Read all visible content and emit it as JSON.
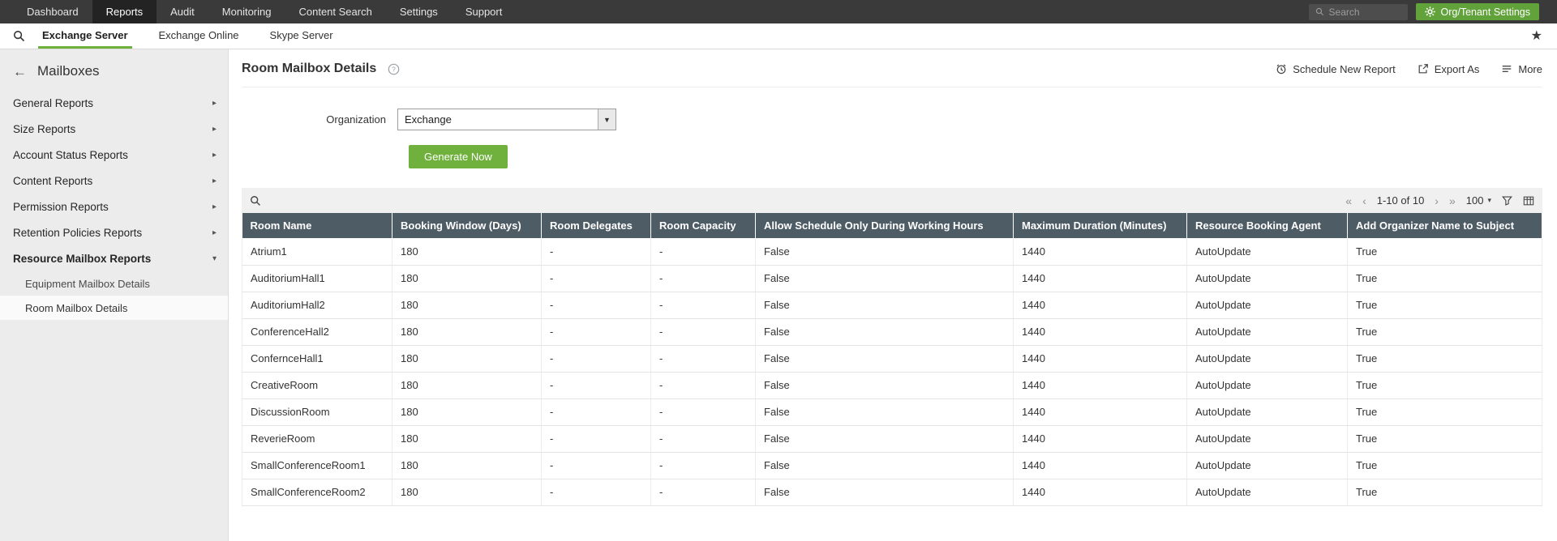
{
  "top_nav": {
    "items": [
      {
        "label": "Dashboard",
        "active": false
      },
      {
        "label": "Reports",
        "active": true
      },
      {
        "label": "Audit",
        "active": false
      },
      {
        "label": "Monitoring",
        "active": false
      },
      {
        "label": "Content Search",
        "active": false
      },
      {
        "label": "Settings",
        "active": false
      },
      {
        "label": "Support",
        "active": false
      }
    ],
    "search_placeholder": "Search",
    "org_settings_label": "Org/Tenant Settings"
  },
  "sub_nav": {
    "tabs": [
      {
        "label": "Exchange Server",
        "active": true
      },
      {
        "label": "Exchange Online",
        "active": false
      },
      {
        "label": "Skype Server",
        "active": false
      }
    ]
  },
  "sidebar": {
    "title": "Mailboxes",
    "items": [
      {
        "label": "General Reports",
        "expanded": false
      },
      {
        "label": "Size Reports",
        "expanded": false
      },
      {
        "label": "Account Status Reports",
        "expanded": false
      },
      {
        "label": "Content Reports",
        "expanded": false
      },
      {
        "label": "Permission Reports",
        "expanded": false
      },
      {
        "label": "Retention Policies Reports",
        "expanded": false
      },
      {
        "label": "Resource Mailbox Reports",
        "expanded": true,
        "children": [
          {
            "label": "Equipment Mailbox Details",
            "selected": false
          },
          {
            "label": "Room Mailbox Details",
            "selected": true
          }
        ]
      }
    ]
  },
  "main": {
    "title": "Room Mailbox Details",
    "actions": {
      "schedule": "Schedule New Report",
      "export": "Export As",
      "more": "More"
    },
    "form": {
      "organization_label": "Organization",
      "organization_value": "Exchange"
    },
    "generate_button": "Generate Now",
    "pagination": {
      "range": "1-10 of 10",
      "page_size": "100"
    },
    "table": {
      "columns": [
        "Room Name",
        "Booking Window (Days)",
        "Room Delegates",
        "Room Capacity",
        "Allow Schedule Only During Working Hours",
        "Maximum Duration (Minutes)",
        "Resource Booking Agent",
        "Add Organizer Name to Subject"
      ],
      "rows": [
        [
          "Atrium1",
          "180",
          "-",
          "-",
          "False",
          "1440",
          "AutoUpdate",
          "True"
        ],
        [
          "AuditoriumHall1",
          "180",
          "-",
          "-",
          "False",
          "1440",
          "AutoUpdate",
          "True"
        ],
        [
          "AuditoriumHall2",
          "180",
          "-",
          "-",
          "False",
          "1440",
          "AutoUpdate",
          "True"
        ],
        [
          "ConferenceHall2",
          "180",
          "-",
          "-",
          "False",
          "1440",
          "AutoUpdate",
          "True"
        ],
        [
          "ConfernceHall1",
          "180",
          "-",
          "-",
          "False",
          "1440",
          "AutoUpdate",
          "True"
        ],
        [
          "CreativeRoom",
          "180",
          "-",
          "-",
          "False",
          "1440",
          "AutoUpdate",
          "True"
        ],
        [
          "DiscussionRoom",
          "180",
          "-",
          "-",
          "False",
          "1440",
          "AutoUpdate",
          "True"
        ],
        [
          "ReverieRoom",
          "180",
          "-",
          "-",
          "False",
          "1440",
          "AutoUpdate",
          "True"
        ],
        [
          "SmallConferenceRoom1",
          "180",
          "-",
          "-",
          "False",
          "1440",
          "AutoUpdate",
          "True"
        ],
        [
          "SmallConferenceRoom2",
          "180",
          "-",
          "-",
          "False",
          "1440",
          "AutoUpdate",
          "True"
        ]
      ]
    }
  },
  "icons": {
    "star": "★",
    "back_arrow": "←",
    "chevron_right": "▸",
    "chevron_down": "▾",
    "select_caret": "▼",
    "first_page": "«",
    "prev_page": "‹",
    "next_page": "›",
    "last_page": "»",
    "page_size_caret": "▾"
  },
  "colors": {
    "accent_green": "#6fb13c",
    "org_button_green": "#61a23a",
    "table_header_bg": "#4e5c66",
    "top_nav_bg": "#3a3a3a",
    "top_nav_active_bg": "#232323",
    "sidebar_bg": "#ececec"
  }
}
